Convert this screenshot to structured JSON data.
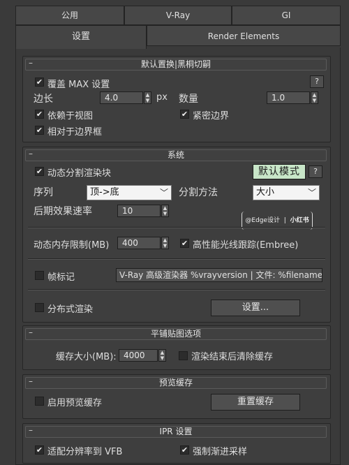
{
  "tabs": {
    "row1": [
      "公用",
      "V-Ray",
      "GI"
    ],
    "row2": [
      "设置",
      "Render Elements"
    ]
  },
  "rollouts": {
    "minus": "–",
    "displacement": {
      "title": "默认置换|黑桐切嗣",
      "help": "?",
      "override_max": "覆盖 MAX 设置",
      "edge_label": "边长",
      "edge_value": "4.0",
      "edge_unit": "px",
      "amount_label": "数量",
      "amount_value": "1.0",
      "view_dependent": "依赖于视图",
      "tight_bounds": "紧密边界",
      "relative_bbox": "相对于边界框"
    },
    "system": {
      "title": "系统",
      "dynamic_split": "动态分割渲染块",
      "default_mode": "默认模式",
      "help": "?",
      "sequence_label": "序列",
      "sequence_value": "顶->底",
      "split_method_label": "分割方法",
      "split_method_value": "大小",
      "post_rate_label": "后期效果速率",
      "post_rate_value": "10",
      "watermark_user": "@Edge设计",
      "watermark_brand": "小红书",
      "dyn_mem_label": "动态内存限制(MB)",
      "dyn_mem_value": "400",
      "embree": "高性能光线跟踪(Embree)",
      "frame_stamp": "帧标记",
      "frame_stamp_text": "V-Ray 高级渲染器 %vrayversion | 文件: %filename",
      "distributed": "分布式渲染",
      "settings_button": "设置..."
    },
    "tiled": {
      "title": "平铺贴图选项",
      "cache_label": "缓存大小(MB):",
      "cache_value": "4000",
      "clear_cache": "渲染结束后清除缓存"
    },
    "preview": {
      "title": "预览缓存",
      "enable": "启用预览缓存",
      "reset": "重置缓存"
    },
    "ipr": {
      "title": "IPR 设置",
      "fit_vfb": "适配分辨率到 VFB",
      "force_progressive": "强制渐进采样"
    }
  },
  "check_glyph": "✔",
  "colors": {
    "background": "#3a3a3a",
    "default_mode_bg": "#c8e6c8"
  }
}
